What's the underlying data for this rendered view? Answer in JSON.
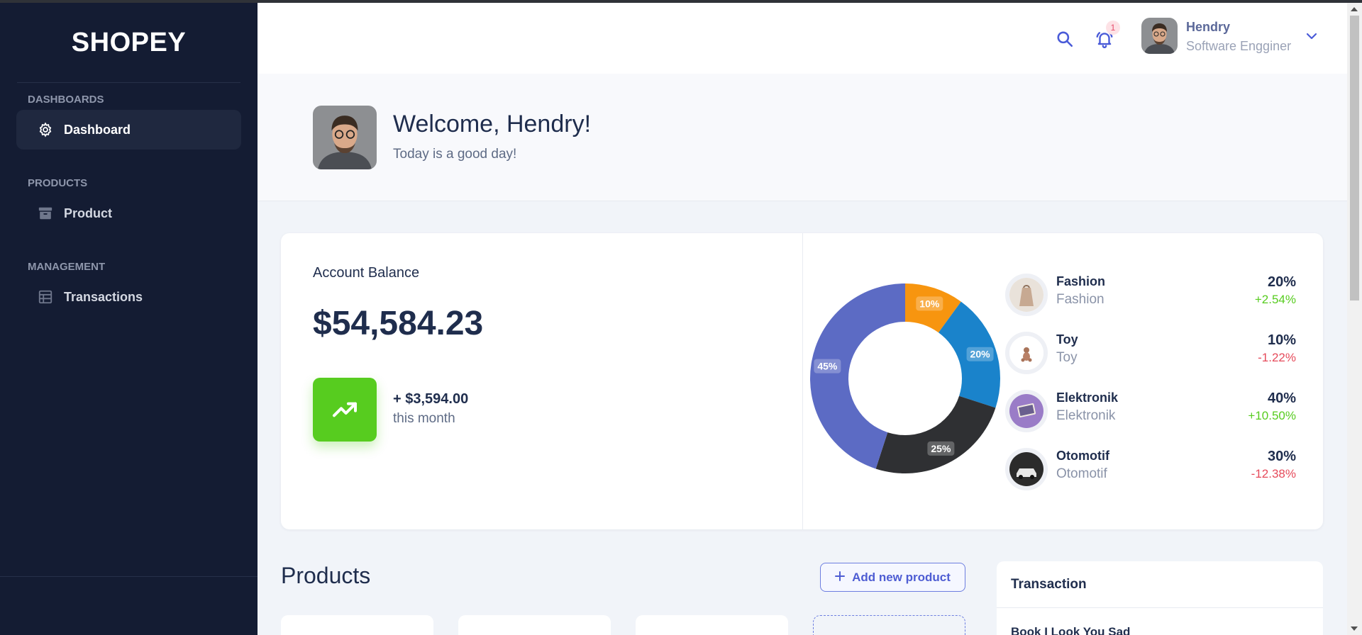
{
  "brand": "SHOPEY",
  "sidebar": {
    "sections": [
      {
        "heading": "DASHBOARDS",
        "items": [
          {
            "label": "Dashboard",
            "icon": "gear-icon",
            "active": true
          }
        ]
      },
      {
        "heading": "PRODUCTS",
        "items": [
          {
            "label": "Product",
            "icon": "archive-icon"
          }
        ]
      },
      {
        "heading": "MANAGEMENT",
        "items": [
          {
            "label": "Transactions",
            "icon": "table-icon"
          }
        ]
      }
    ]
  },
  "header": {
    "notification_count": "1",
    "user_name": "Hendry",
    "user_role": "Software Engginer",
    "icons": [
      "search-icon",
      "bell-icon",
      "chevron-down-icon"
    ]
  },
  "welcome": {
    "title": "Welcome, Hendry!",
    "subtitle": "Today is a good day!"
  },
  "balance": {
    "label": "Account Balance",
    "value": "$54,584.23",
    "change": "+ $3,594.00",
    "change_caption": "this month"
  },
  "chart_data": {
    "type": "pie",
    "categories": [
      "Otomotif",
      "Fashion",
      "Toy",
      "Elektronik"
    ],
    "values": [
      10,
      20,
      25,
      45
    ],
    "labels": [
      "10%",
      "20%",
      "25%",
      "45%"
    ],
    "colors": [
      "#f7950f",
      "#1a83cb",
      "#2f3033",
      "#5c6bc4"
    ]
  },
  "categories": [
    {
      "name": "Fashion",
      "sub": "Fashion",
      "pct": "20%",
      "change": "+2.54%",
      "trend": "up"
    },
    {
      "name": "Toy",
      "sub": "Toy",
      "pct": "10%",
      "change": "-1.22%",
      "trend": "down"
    },
    {
      "name": "Elektronik",
      "sub": "Elektronik",
      "pct": "40%",
      "change": "+10.50%",
      "trend": "up"
    },
    {
      "name": "Otomotif",
      "sub": "Otomotif",
      "pct": "30%",
      "change": "-12.38%",
      "trend": "down"
    }
  ],
  "products": {
    "title": "Products",
    "add_label": "Add new product"
  },
  "transaction": {
    "title": "Transaction",
    "first_item": "Book I Look You Sad"
  },
  "colors": {
    "sidebar": "#141c33",
    "accent": "#5c6bc4",
    "green": "#57cc1f",
    "red": "#e64b5b"
  }
}
